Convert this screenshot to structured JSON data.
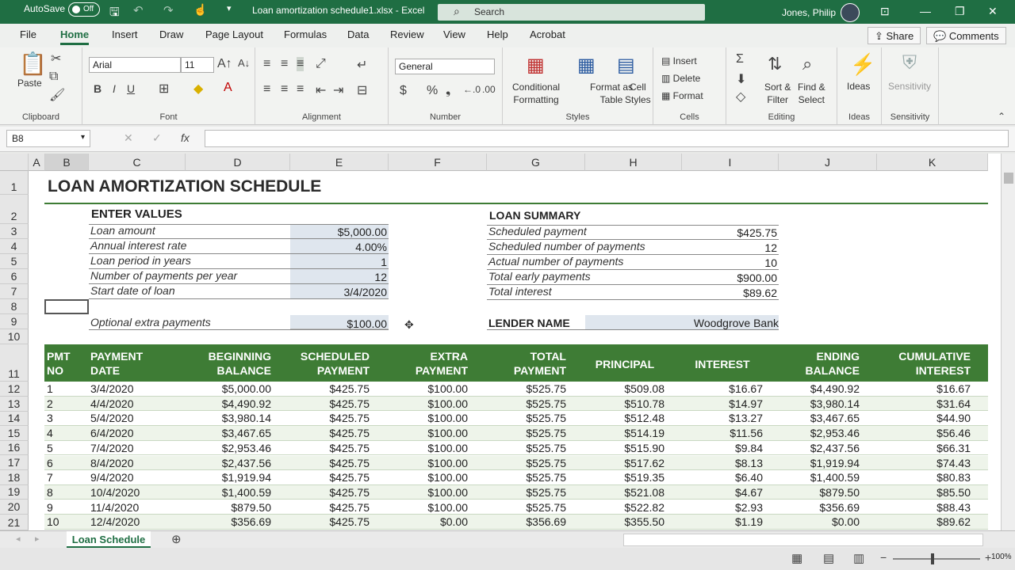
{
  "titlebar": {
    "autosave": "AutoSave",
    "autosave_state": "Off",
    "filename": "Loan amortization schedule1.xlsx - Excel",
    "search": "Search",
    "user": "Jones, Philip"
  },
  "menu": [
    "File",
    "Home",
    "Insert",
    "Draw",
    "Page Layout",
    "Formulas",
    "Data",
    "Review",
    "View",
    "Help",
    "Acrobat"
  ],
  "share": "Share",
  "comments": "Comments",
  "ribbon": {
    "paste": "Paste",
    "clipboard": "Clipboard",
    "font_name": "Arial",
    "font_size": "11",
    "font": "Font",
    "alignment": "Alignment",
    "number_format": "General",
    "number": "Number",
    "conditional": "Conditional",
    "formatting": "Formatting",
    "format_as": "Format as",
    "table": "Table",
    "cell": "Cell",
    "styles_btn": "Styles",
    "styles": "Styles",
    "insert": "Insert",
    "delete": "Delete",
    "format": "Format",
    "cells": "Cells",
    "sort": "Sort &",
    "filter": "Filter",
    "find": "Find &",
    "select": "Select",
    "editing": "Editing",
    "ideas": "Ideas",
    "ideas_grp": "Ideas",
    "sensitivity": "Sensitivity",
    "sensitivity_grp": "Sensitivity",
    "bold": "B",
    "italic": "I",
    "underline": "U"
  },
  "namebox": "B8",
  "columns": [
    "A",
    "B",
    "C",
    "D",
    "E",
    "F",
    "G",
    "H",
    "I",
    "J",
    "K"
  ],
  "rows": [
    "1",
    "2",
    "3",
    "4",
    "5",
    "6",
    "7",
    "8",
    "9",
    "10",
    "11",
    "12",
    "13",
    "14",
    "15",
    "16",
    "17",
    "18",
    "19",
    "20",
    "21"
  ],
  "sheet": {
    "title": "LOAN AMORTIZATION SCHEDULE",
    "enter_values": "ENTER VALUES",
    "loan_summary": "LOAN SUMMARY",
    "inputs": [
      [
        "Loan amount",
        "$5,000.00"
      ],
      [
        "Annual interest rate",
        "4.00%"
      ],
      [
        "Loan period in years",
        "1"
      ],
      [
        "Number of payments per year",
        "12"
      ],
      [
        "Start date of loan",
        "3/4/2020"
      ]
    ],
    "extra_label": "Optional extra payments",
    "extra_value": "$100.00",
    "summary": [
      [
        "Scheduled payment",
        "$425.75"
      ],
      [
        "Scheduled number of payments",
        "12"
      ],
      [
        "Actual number of payments",
        "10"
      ],
      [
        "Total early payments",
        "$900.00"
      ],
      [
        "Total interest",
        "$89.62"
      ]
    ],
    "lender_label": "LENDER NAME",
    "lender_value": "Woodgrove Bank",
    "headers": [
      [
        "PMT",
        "NO"
      ],
      [
        "PAYMENT",
        "DATE"
      ],
      [
        "BEGINNING",
        "BALANCE"
      ],
      [
        "SCHEDULED",
        "PAYMENT"
      ],
      [
        "EXTRA",
        "PAYMENT"
      ],
      [
        "TOTAL",
        "PAYMENT"
      ],
      [
        "PRINCIPAL",
        ""
      ],
      [
        "INTEREST",
        ""
      ],
      [
        "ENDING",
        "BALANCE"
      ],
      [
        "CUMULATIVE",
        "INTEREST"
      ]
    ],
    "data": [
      [
        "1",
        "3/4/2020",
        "$5,000.00",
        "$425.75",
        "$100.00",
        "$525.75",
        "$509.08",
        "$16.67",
        "$4,490.92",
        "$16.67"
      ],
      [
        "2",
        "4/4/2020",
        "$4,490.92",
        "$425.75",
        "$100.00",
        "$525.75",
        "$510.78",
        "$14.97",
        "$3,980.14",
        "$31.64"
      ],
      [
        "3",
        "5/4/2020",
        "$3,980.14",
        "$425.75",
        "$100.00",
        "$525.75",
        "$512.48",
        "$13.27",
        "$3,467.65",
        "$44.90"
      ],
      [
        "4",
        "6/4/2020",
        "$3,467.65",
        "$425.75",
        "$100.00",
        "$525.75",
        "$514.19",
        "$11.56",
        "$2,953.46",
        "$56.46"
      ],
      [
        "5",
        "7/4/2020",
        "$2,953.46",
        "$425.75",
        "$100.00",
        "$525.75",
        "$515.90",
        "$9.84",
        "$2,437.56",
        "$66.31"
      ],
      [
        "6",
        "8/4/2020",
        "$2,437.56",
        "$425.75",
        "$100.00",
        "$525.75",
        "$517.62",
        "$8.13",
        "$1,919.94",
        "$74.43"
      ],
      [
        "7",
        "9/4/2020",
        "$1,919.94",
        "$425.75",
        "$100.00",
        "$525.75",
        "$519.35",
        "$6.40",
        "$1,400.59",
        "$80.83"
      ],
      [
        "8",
        "10/4/2020",
        "$1,400.59",
        "$425.75",
        "$100.00",
        "$525.75",
        "$521.08",
        "$4.67",
        "$879.50",
        "$85.50"
      ],
      [
        "9",
        "11/4/2020",
        "$879.50",
        "$425.75",
        "$100.00",
        "$525.75",
        "$522.82",
        "$2.93",
        "$356.69",
        "$88.43"
      ],
      [
        "10",
        "12/4/2020",
        "$356.69",
        "$425.75",
        "$0.00",
        "$356.69",
        "$355.50",
        "$1.19",
        "$0.00",
        "$89.62"
      ]
    ]
  },
  "sheet_tab": "Loan Schedule",
  "zoom": "100%"
}
